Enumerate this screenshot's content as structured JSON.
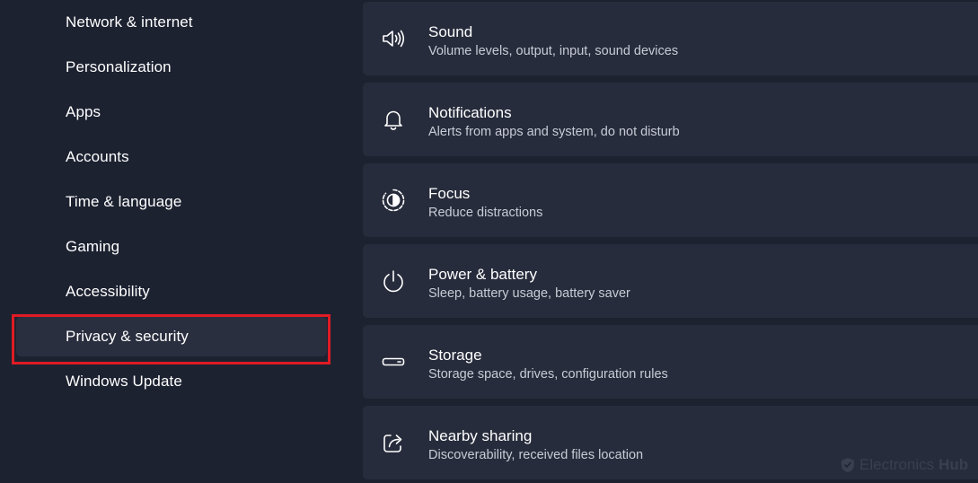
{
  "sidebar": {
    "items": [
      {
        "label": "Network & internet"
      },
      {
        "label": "Personalization"
      },
      {
        "label": "Apps"
      },
      {
        "label": "Accounts"
      },
      {
        "label": "Time & language"
      },
      {
        "label": "Gaming"
      },
      {
        "label": "Accessibility"
      },
      {
        "label": "Privacy & security",
        "selected": true
      },
      {
        "label": "Windows Update"
      }
    ]
  },
  "cards": [
    {
      "title": "Sound",
      "subtitle": "Volume levels, output, input, sound devices",
      "icon": "speaker-icon"
    },
    {
      "title": "Notifications",
      "subtitle": "Alerts from apps and system, do not disturb",
      "icon": "bell-icon"
    },
    {
      "title": "Focus",
      "subtitle": "Reduce distractions",
      "icon": "focus-icon"
    },
    {
      "title": "Power & battery",
      "subtitle": "Sleep, battery usage, battery saver",
      "icon": "power-icon"
    },
    {
      "title": "Storage",
      "subtitle": "Storage space, drives, configuration rules",
      "icon": "storage-icon"
    },
    {
      "title": "Nearby sharing",
      "subtitle": "Discoverability, received files location",
      "icon": "share-icon"
    }
  ],
  "highlight_color": "#e01b24",
  "watermark": {
    "brand": "Electronics",
    "brand_bold": "Hub"
  }
}
